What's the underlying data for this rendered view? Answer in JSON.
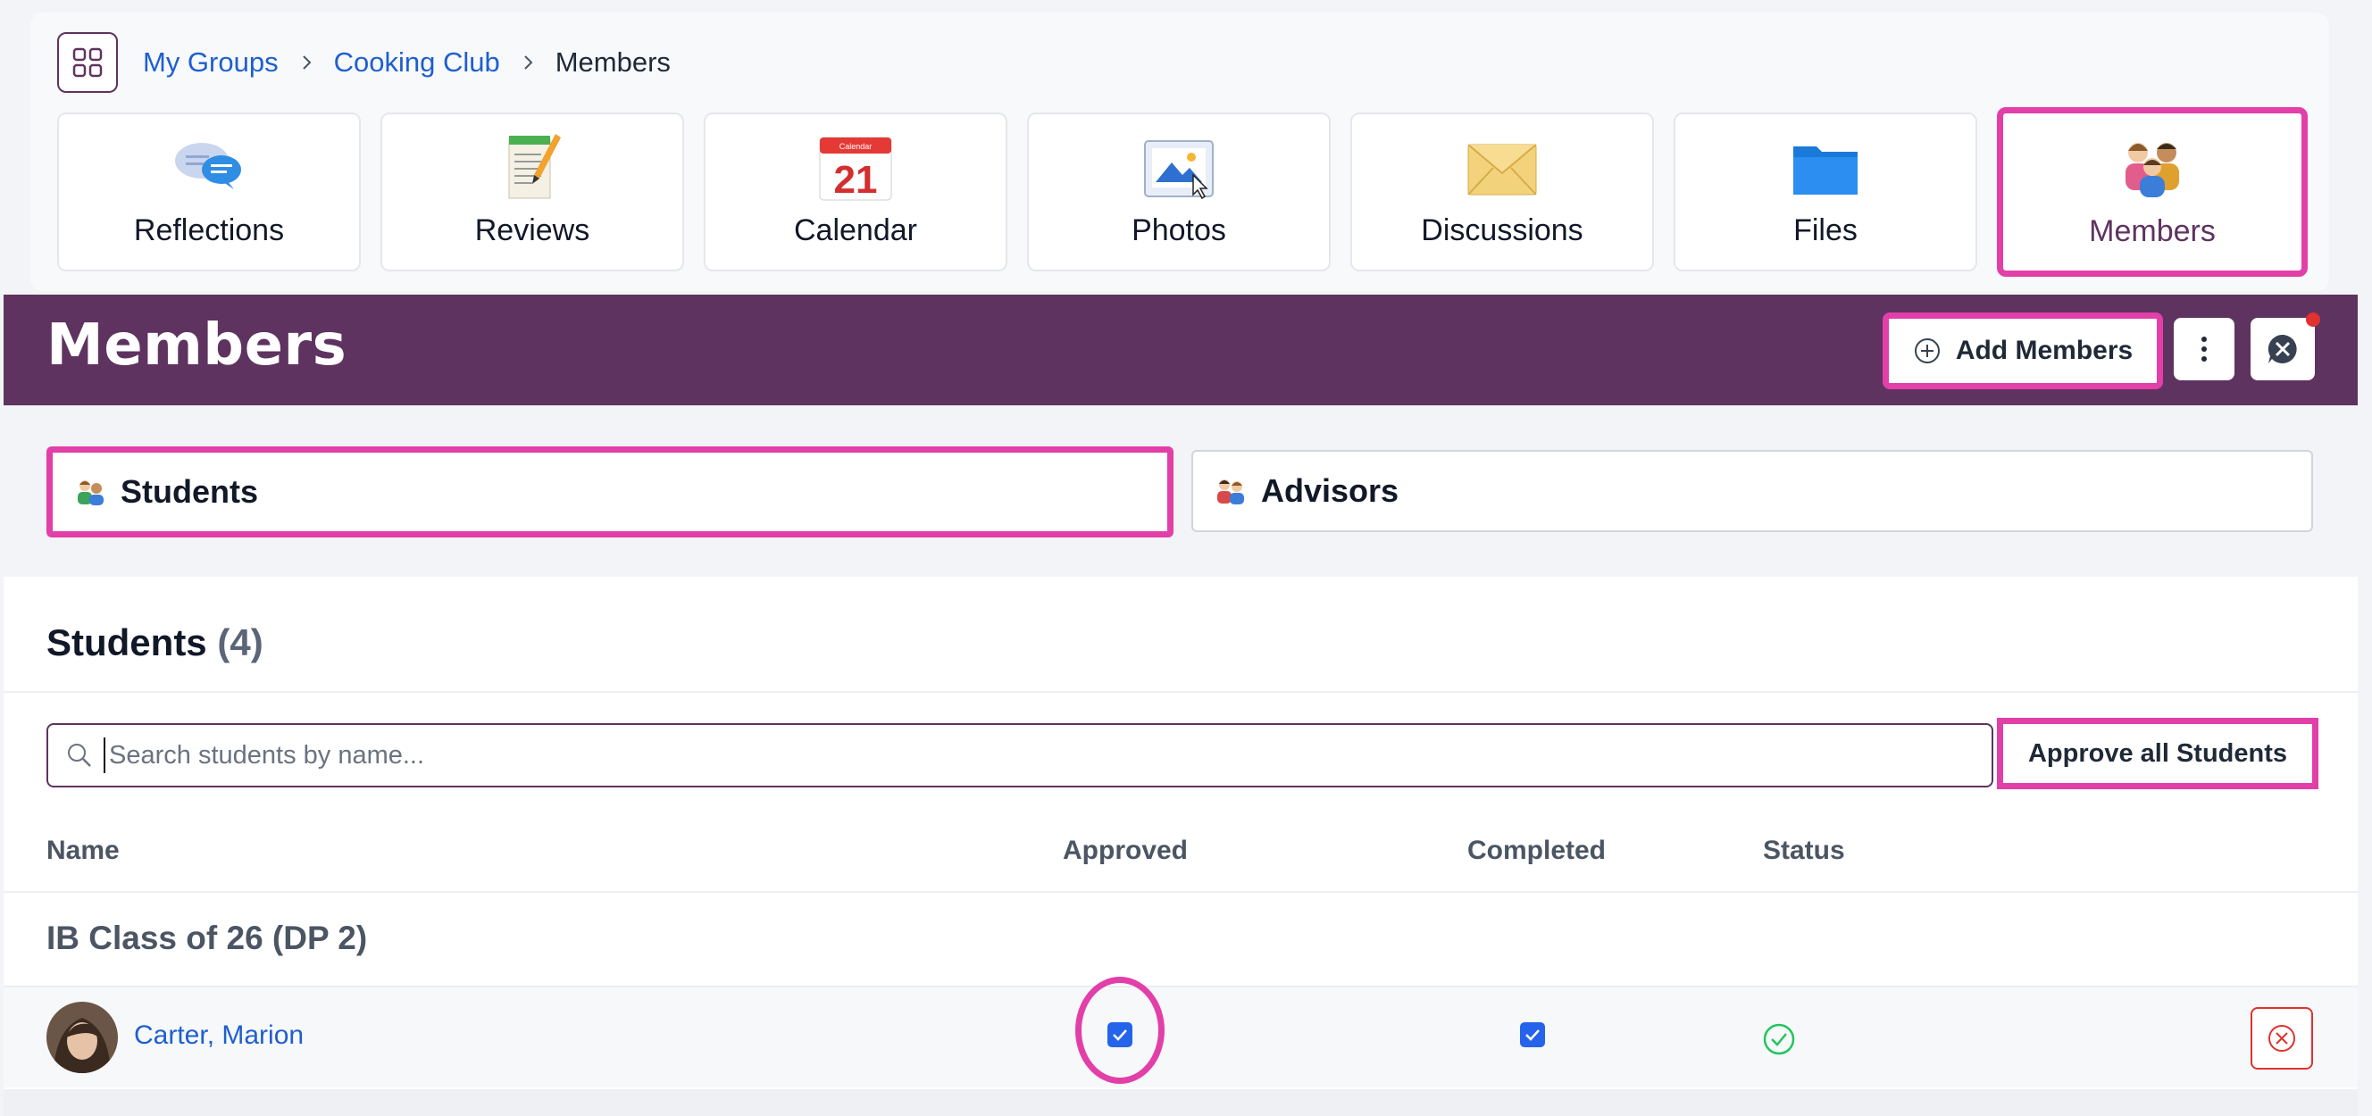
{
  "breadcrumb": {
    "items": [
      "My Groups",
      "Cooking Club",
      "Members"
    ]
  },
  "tools": [
    {
      "label": "Reflections",
      "icon": "speech-bubbles-icon"
    },
    {
      "label": "Reviews",
      "icon": "notepad-pencil-icon"
    },
    {
      "label": "Calendar",
      "icon": "calendar-icon",
      "calendar_header": "Calendar",
      "calendar_day": "21"
    },
    {
      "label": "Photos",
      "icon": "photo-icon"
    },
    {
      "label": "Discussions",
      "icon": "envelope-icon"
    },
    {
      "label": "Files",
      "icon": "folder-icon"
    },
    {
      "label": "Members",
      "icon": "people-group-icon",
      "active": true
    }
  ],
  "header": {
    "title": "Members",
    "add_members_label": "Add Members",
    "has_notification": true
  },
  "role_tabs": [
    {
      "label": "Students",
      "selected": true
    },
    {
      "label": "Advisors",
      "selected": false
    }
  ],
  "section": {
    "title": "Students",
    "count": "(4)"
  },
  "search": {
    "placeholder": "Search students by name...",
    "value": ""
  },
  "approve_all_label": "Approve all Students",
  "table": {
    "columns": [
      "Name",
      "Approved",
      "Completed",
      "Status"
    ],
    "group": "IB Class of 26 (DP 2)",
    "rows": [
      {
        "name": "Carter, Marion",
        "approved": true,
        "completed": true,
        "status": "complete"
      }
    ]
  },
  "colors": {
    "brand_purple": "#5e3360",
    "link_blue": "#1e5fcf",
    "highlight_pink": "#e23fa8",
    "danger_red": "#e0322e",
    "status_green": "#22c55e"
  }
}
